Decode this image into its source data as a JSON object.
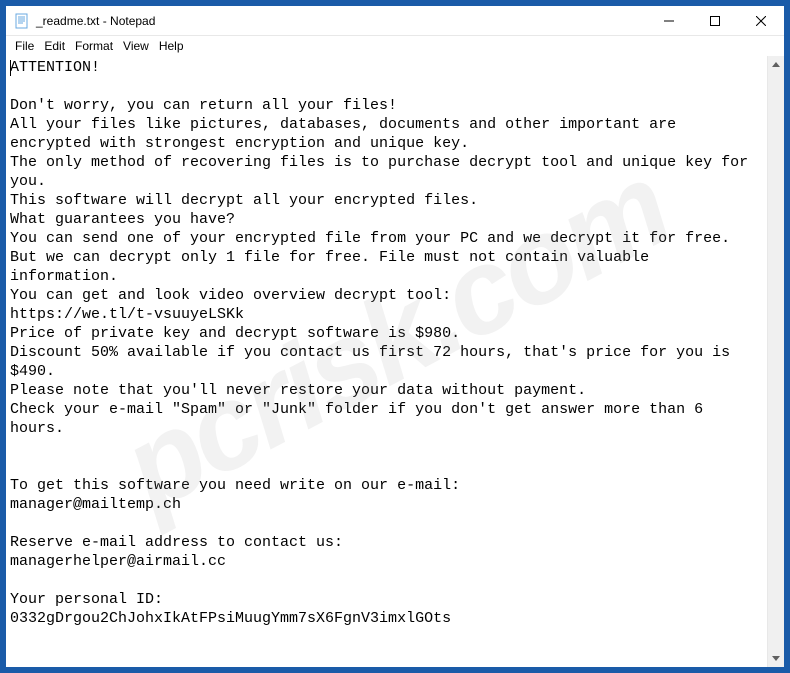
{
  "window": {
    "title": "_readme.txt - Notepad"
  },
  "menu": {
    "file": "File",
    "edit": "Edit",
    "format": "Format",
    "view": "View",
    "help": "Help"
  },
  "document": {
    "text": "ATTENTION!\n\nDon't worry, you can return all your files!\nAll your files like pictures, databases, documents and other important are encrypted with strongest encryption and unique key.\nThe only method of recovering files is to purchase decrypt tool and unique key for you.\nThis software will decrypt all your encrypted files.\nWhat guarantees you have?\nYou can send one of your encrypted file from your PC and we decrypt it for free.\nBut we can decrypt only 1 file for free. File must not contain valuable information.\nYou can get and look video overview decrypt tool:\nhttps://we.tl/t-vsuuyeLSKk\nPrice of private key and decrypt software is $980.\nDiscount 50% available if you contact us first 72 hours, that's price for you is $490.\nPlease note that you'll never restore your data without payment.\nCheck your e-mail \"Spam\" or \"Junk\" folder if you don't get answer more than 6 hours.\n\n\nTo get this software you need write on our e-mail:\nmanager@mailtemp.ch\n\nReserve e-mail address to contact us:\nmanagerhelper@airmail.cc\n\nYour personal ID:\n0332gDrgou2ChJohxIkAtFPsiMuugYmm7sX6FgnV3imxlGOts"
  },
  "watermark": "pcrisk.com"
}
